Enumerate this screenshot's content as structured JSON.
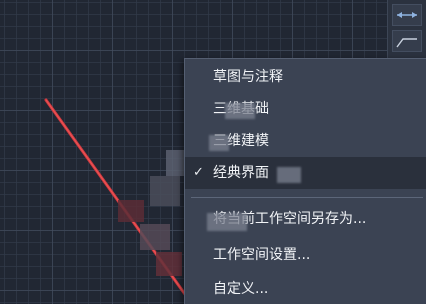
{
  "context_menu": {
    "items": [
      {
        "label": "草图与注释",
        "checked": false,
        "hover": false
      },
      {
        "label": "三维基础",
        "checked": false,
        "hover": false
      },
      {
        "label": "三维建模",
        "checked": false,
        "hover": false
      },
      {
        "label": "经典界面",
        "checked": true,
        "hover": true
      },
      {
        "label": "将当前工作空间另存为...",
        "checked": false,
        "hover": false
      },
      {
        "label": "工作空间设置...",
        "checked": false,
        "hover": false
      },
      {
        "label": "自定义...",
        "checked": false,
        "hover": false
      }
    ],
    "check_glyph": "✓"
  },
  "colors": {
    "canvas_bg": "#212733",
    "line": "#d23a3f",
    "menu_bg": "#3b4353",
    "menu_hover": "#2a303c",
    "menu_text": "#f2f4f7"
  },
  "side_tools": [
    {
      "icon": "arrow-align-icon"
    },
    {
      "icon": "polyline-icon"
    }
  ]
}
